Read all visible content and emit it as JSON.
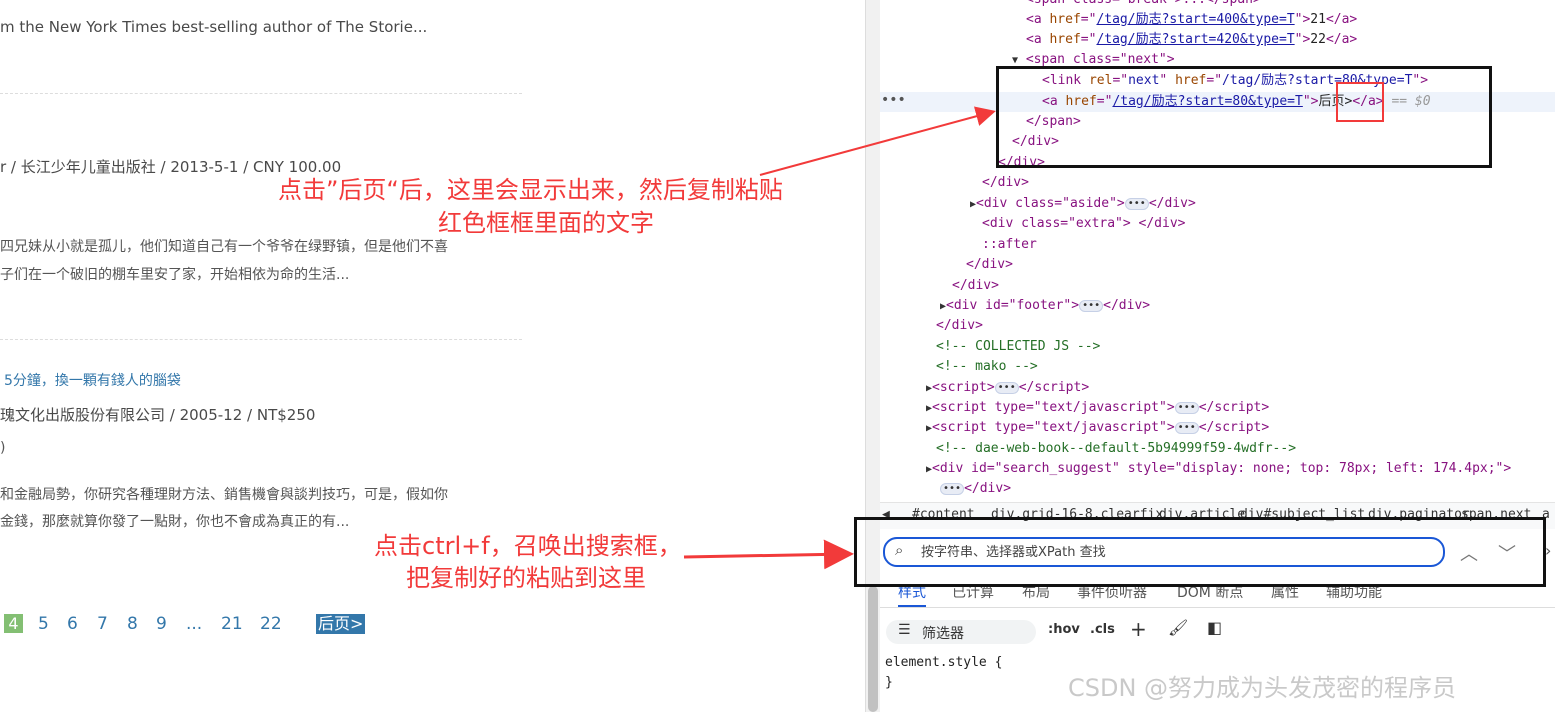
{
  "left": {
    "line1": "m the New York Times best-selling author of The Storie...",
    "book2_meta": "r / 长江少年儿童出版社 / 2013-5-1 / CNY 100.00",
    "book2_desc1": "四兄妹从小就是孤儿，他们知道自己有一个爷爷在绿野镇，但是他们不喜",
    "book2_desc2": "子们在一个破旧的棚车里安了家，开始相依为命的生活...",
    "book3_title": "5分鐘，換一顆有錢人的腦袋",
    "book3_meta": "瑰文化出版股份有限公司 / 2005-12 / NT$250",
    "book3_rating": ")",
    "book3_desc1": "和金融局勢，你研究各種理財方法、銷售機會與談判技巧，可是，假如你",
    "book3_desc2": "金錢，那麼就算你發了一點財，你也不會成為真正的有...",
    "paginator": {
      "current": "4",
      "pages": [
        "5",
        "6",
        "7",
        "8",
        "9",
        "...",
        "21",
        "22"
      ],
      "next": "后页>"
    }
  },
  "annotations": {
    "a1_line1": "点击”后页“后，这里会显示出来，然后复制粘贴",
    "a1_line2": "红色框框里面的文字",
    "a2_line1": "点击ctrl+f，召唤出搜索框，",
    "a2_line2": "把复制好的粘贴到这里"
  },
  "devtools": {
    "code": {
      "l0": "<span class=\"break\">...</span>",
      "l1_href": "/tag/励志?start=400&type=T",
      "l1_text": "21",
      "l2_href": "/tag/励志?start=420&type=T",
      "l2_text": "22",
      "l3": "<span class=\"next\">",
      "l4_href": "/tag/励志?start=80&type=T",
      "l5_href": "/tag/励志?start=80&type=T",
      "l5_text": "后页>",
      "l5_suffix": "== $0",
      "l6": "</span>",
      "l7": "</div>",
      "l8": "</div>",
      "l9": "</div>",
      "l10": "<div class=\"aside\">",
      "l11": "<div class=\"extra\"> </div>",
      "l12": "::after",
      "l13": "</div>",
      "l14": "</div>",
      "l15": "<div id=\"footer\">",
      "l16": "</div>",
      "l17": "<!-- COLLECTED JS -->",
      "l18": "<!-- mako -->",
      "l19": "<script>",
      "l20": "<script type=\"text/javascript\">",
      "l21": "<script type=\"text/javascript\">",
      "l22": "<!-- dae-web-book--default-5b94999f59-4wdfr-->",
      "l23": "<div id=\"search_suggest\" style=\"display: none; top: 78px; left: 174.4px;\">",
      "l24": "</div>"
    },
    "breadcrumbs": [
      "#content",
      "div.grid-16-8.clearfix",
      "div.article",
      "div#subject_list",
      "div.paginator",
      "span.next",
      "a"
    ],
    "search_placeholder": "按字符串、选择器或XPath 查找",
    "tabs": [
      "样式",
      "已计算",
      "布局",
      "事件侦听器",
      "DOM 断点",
      "属性",
      "辅助功能"
    ],
    "filter_label": "筛选器",
    "hov": ":hov",
    "cls": ".cls",
    "styles_rule": "element.style {",
    "styles_close": "}"
  },
  "watermark": "CSDN @努力成为头发茂密的程序员",
  "colors": {
    "annotation": "#f23a3a",
    "link": "#3377aa",
    "current_page": "#83bf73"
  }
}
